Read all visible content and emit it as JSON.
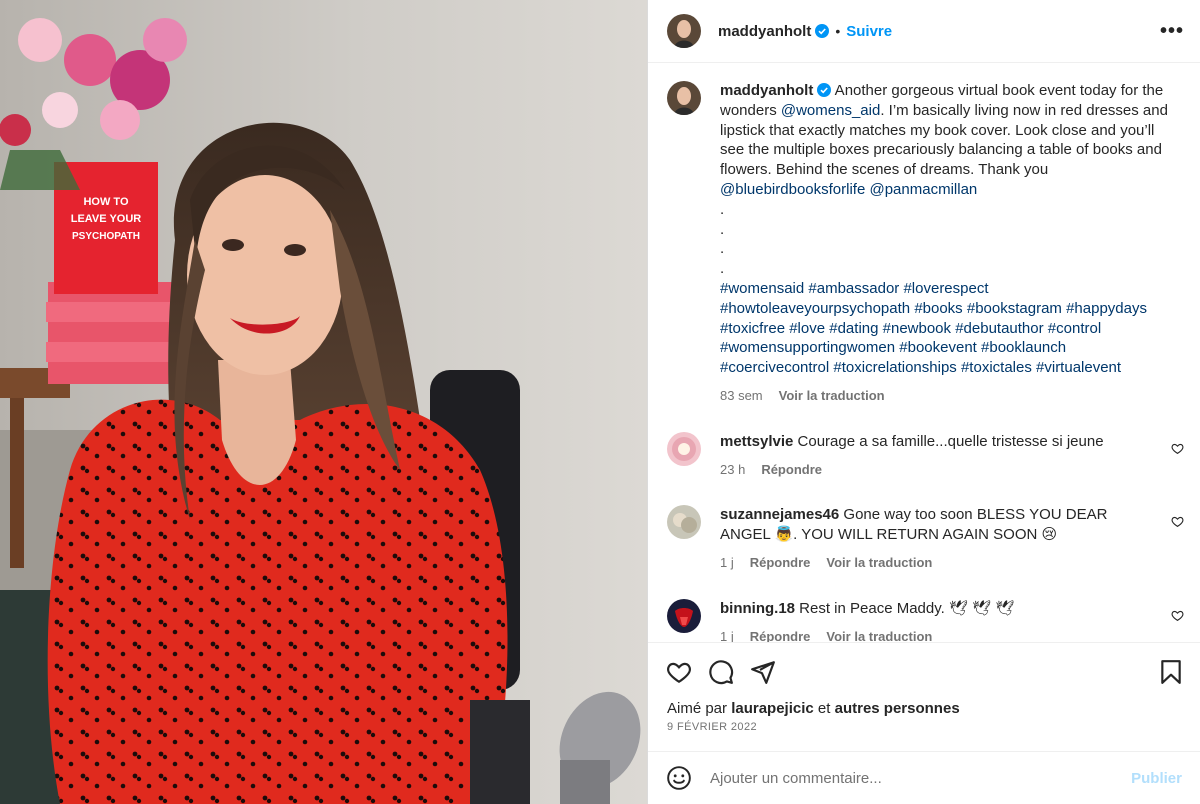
{
  "header": {
    "username": "maddyanholt",
    "separator": "•",
    "follow_label": "Suivre",
    "more_label": "•••"
  },
  "photo": {
    "book_title": "HOW TO LEAVE YOUR PSYCHOPATH"
  },
  "caption": {
    "username": "maddyanholt",
    "text_1": " Another gorgeous virtual book event today for the wonders ",
    "mention_1": "@womens_aid",
    "text_2": ". I’m basically living now in red dresses and lipstick that exactly matches my book cover. Look close and you’ll see the multiple boxes precariously balancing a table of books and flowers. Behind the scenes of dreams. Thank you ",
    "mention_2": "@bluebirdbooksforlife",
    "mention_3": "@panmacmillan",
    "dots": [
      ".",
      ".",
      ".",
      "."
    ],
    "hashtags": [
      "#womensaid",
      "#ambassador",
      "#loverespect",
      "#howtoleaveyourpsychopath",
      "#books",
      "#bookstagram",
      "#happydays",
      "#toxicfree",
      "#love",
      "#dating",
      "#newbook",
      "#debutauthor",
      "#control",
      "#womensupportingwomen",
      "#bookevent",
      "#booklaunch",
      "#coercivecontrol",
      "#toxicrelationships",
      "#toxictales",
      "#virtualevent"
    ],
    "time": "83 sem",
    "translate_label": "Voir la traduction"
  },
  "comments": [
    {
      "username": "mettsylvie",
      "text": " Courage a sa famille...quelle tristesse si jeune",
      "time": "23 h",
      "reply": "Répondre",
      "translate": ""
    },
    {
      "username": "suzannejames46",
      "text": " Gone way too soon BLESS YOU DEAR ANGEL 👼. YOU WILL RETURN AGAIN SOON 😢",
      "time": "1 j",
      "reply": "Répondre",
      "translate": "Voir la traduction"
    },
    {
      "username": "binning.18",
      "text": " Rest in Peace Maddy. 🕊 🕊 🕊",
      "time": "1 j",
      "reply": "Répondre",
      "translate": "Voir la traduction"
    }
  ],
  "likes": {
    "prefix": "Aimé par ",
    "user": "laurapejicic",
    "mid": " et ",
    "others": "autres personnes"
  },
  "date": "9 FÉVRIER 2022",
  "add_comment": {
    "placeholder": "Ajouter un commentaire...",
    "publish_label": "Publier"
  },
  "colors": {
    "link": "#00376b",
    "follow": "#0095f6",
    "verified": "#0095f6",
    "dress": "#e02a1e",
    "publish_disabled": "#b2dffc"
  }
}
